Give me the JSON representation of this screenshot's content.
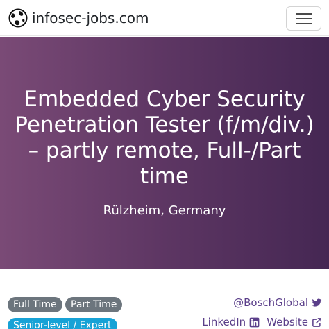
{
  "brand": {
    "name": "infosec-jobs.com",
    "logo_icon": "globe-lock-logo-icon"
  },
  "navbar": {
    "menu_icon": "hamburger-menu-icon"
  },
  "job": {
    "title": "Embedded Cyber Security Penetration Tester (f/m/div.) – partly remote, Full-/Part time",
    "location": "Rülzheim, Germany"
  },
  "badges": {
    "full_time": "Full Time",
    "part_time": "Part Time",
    "level": "Senior-level / Expert"
  },
  "links": {
    "twitter": "@BoschGlobal",
    "linkedin": "LinkedIn",
    "website": "Website"
  },
  "colors": {
    "hero_gradient_start": "#7a4a76",
    "hero_gradient_end": "#452753",
    "link": "#5b3f8a",
    "badge_grey": "#6c757d",
    "badge_blue": "#17a2d6"
  }
}
